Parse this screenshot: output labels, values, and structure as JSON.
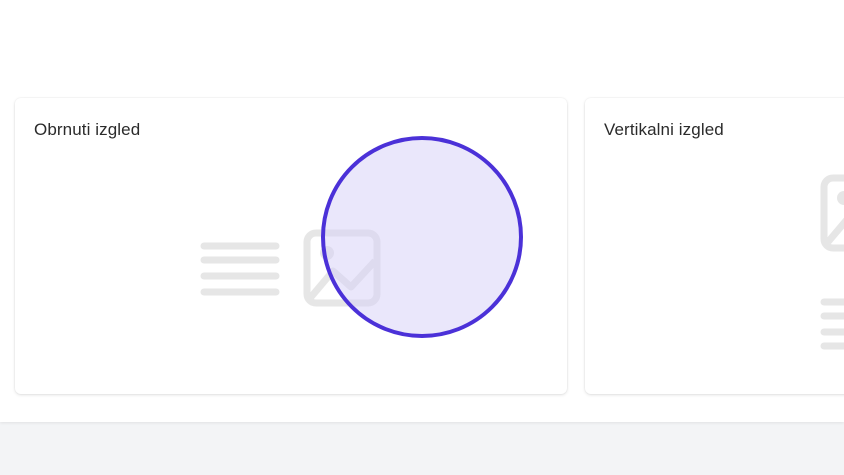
{
  "cards": [
    {
      "title": "Obrnuti izgled",
      "icons": [
        "text-lines-icon",
        "image-placeholder-icon"
      ]
    },
    {
      "title": "Vertikalni izgled",
      "icons": [
        "image-placeholder-icon",
        "text-lines-icon"
      ]
    }
  ],
  "colors": {
    "accent": "#4b31d8",
    "icon": "#e6e6e6",
    "background": "#f3f4f6"
  }
}
